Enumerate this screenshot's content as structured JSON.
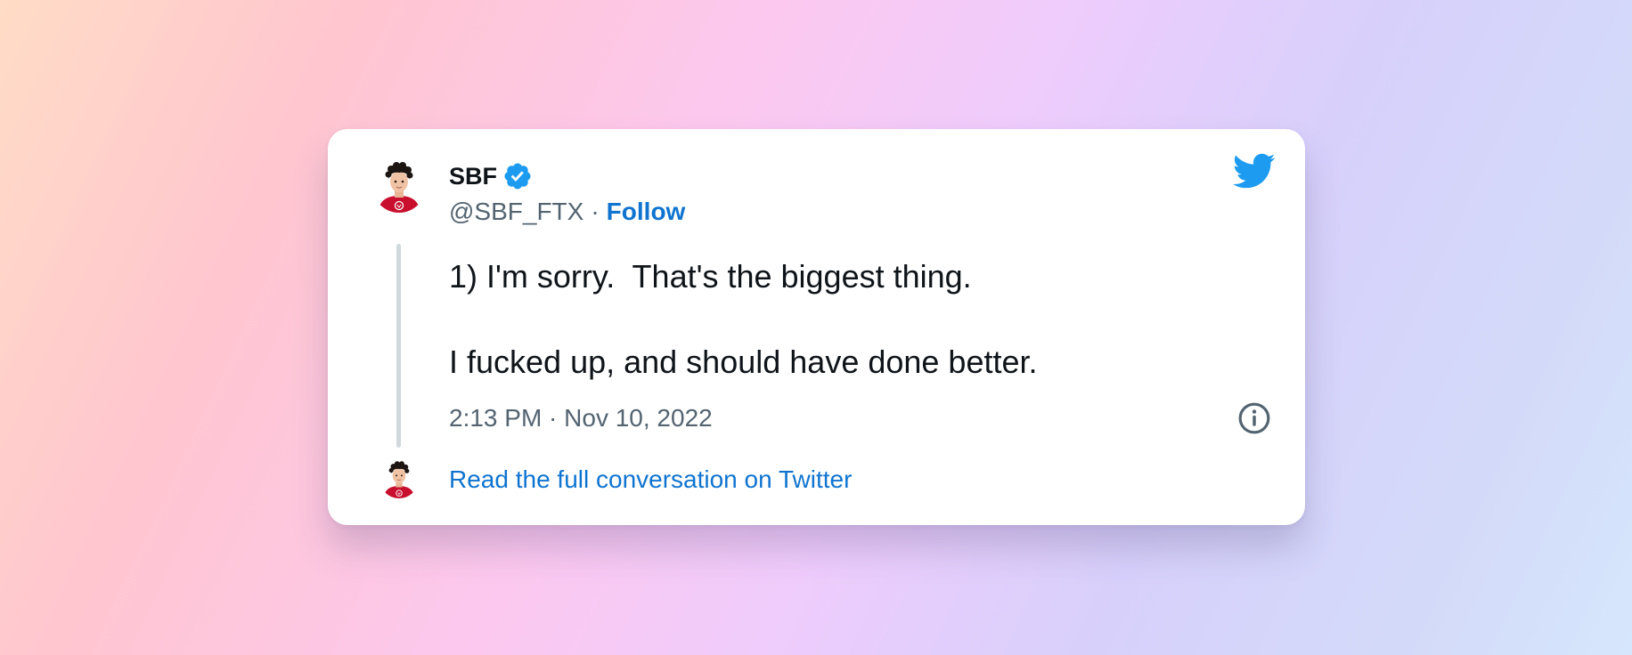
{
  "tweet": {
    "author": {
      "display_name": "SBF",
      "handle": "@SBF_FTX",
      "verified": true,
      "avatar_icon": "profile-avatar-illustration"
    },
    "follow_label": "Follow",
    "separator": "·",
    "text_lines": [
      "1) I'm sorry.  That's the biggest thing.",
      "I fucked up, and should have done better."
    ],
    "timestamp": "2:13 PM · Nov 10, 2022",
    "read_more_label": "Read the full conversation on Twitter",
    "icons": {
      "brand": "twitter-bird-icon",
      "verified": "verified-badge-icon",
      "info": "info-icon"
    }
  },
  "colors": {
    "link": "#0f74d0",
    "verified": "#1d9bf0",
    "twitter_brand": "#1d9bf0",
    "text_primary": "#0f1419",
    "text_secondary": "#536471",
    "thread_line": "#cfd9de",
    "card_background": "#ffffff"
  }
}
